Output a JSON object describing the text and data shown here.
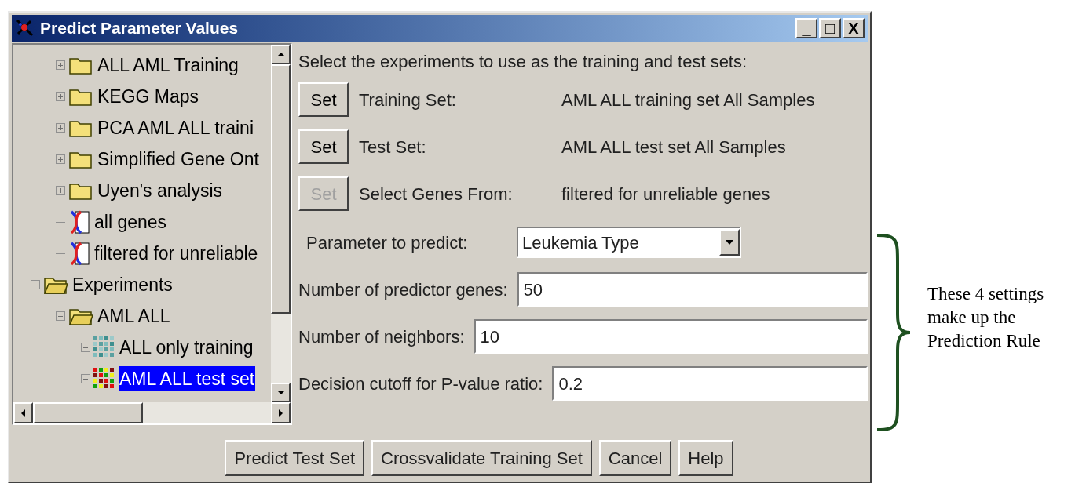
{
  "window": {
    "title": "Predict Parameter Values",
    "controls": [
      "_",
      "□",
      "X"
    ]
  },
  "tree": [
    {
      "kind": "offscreen",
      "children": [
        {
          "label": "ALL AML Training",
          "kind": "folder",
          "expanded": false,
          "selected": false
        },
        {
          "label": "KEGG Maps",
          "kind": "folder",
          "expanded": false,
          "selected": false
        },
        {
          "label": "PCA AML ALL traini",
          "kind": "folder",
          "expanded": false,
          "selected": false
        },
        {
          "label": "Simplified Gene Ont",
          "kind": "folder",
          "expanded": false,
          "selected": false
        },
        {
          "label": "Uyen's analysis",
          "kind": "folder",
          "expanded": false,
          "selected": false
        },
        {
          "label": "all genes",
          "kind": "genelist",
          "selected": false
        },
        {
          "label": "filtered for unreliable",
          "kind": "genelist",
          "selected": false
        }
      ]
    },
    {
      "label": "Experiments",
      "kind": "folder",
      "expanded": true,
      "selected": false,
      "children": [
        {
          "label": "AML ALL",
          "kind": "folder",
          "expanded": true,
          "selected": false,
          "children": [
            {
              "label": "ALL only training",
              "kind": "experiment_teal",
              "expanded": false,
              "selected": false
            },
            {
              "label": "AML ALL test set",
              "kind": "experiment_color",
              "expanded": false,
              "selected": true
            }
          ]
        }
      ]
    }
  ],
  "instructions": "Select the experiments to use as the training and test sets:",
  "set_rows": [
    {
      "button": "Set",
      "label": "Training Set:",
      "value": "AML ALL training set All Samples",
      "disabled": false
    },
    {
      "button": "Set",
      "label": "Test Set:",
      "value": "AML ALL test set All Samples",
      "disabled": false
    },
    {
      "button": "Set",
      "label": "Select Genes From:",
      "value": "filtered for unreliable genes",
      "disabled": true
    }
  ],
  "settings": [
    {
      "kind": "select",
      "label": "Parameter to predict:",
      "value": "Leukemia Type"
    },
    {
      "kind": "text",
      "label": "Number of predictor genes:",
      "value": "50"
    },
    {
      "kind": "text",
      "label": "Number of neighbors:",
      "value": "10"
    },
    {
      "kind": "text",
      "label": "Decision cutoff for P-value ratio:",
      "value": "0.2"
    }
  ],
  "buttons": [
    "Predict Test Set",
    "Crossvalidate Training Set",
    "Cancel",
    "Help"
  ],
  "annotation": [
    "These 4 settings",
    "make up the",
    "Prediction Rule"
  ]
}
